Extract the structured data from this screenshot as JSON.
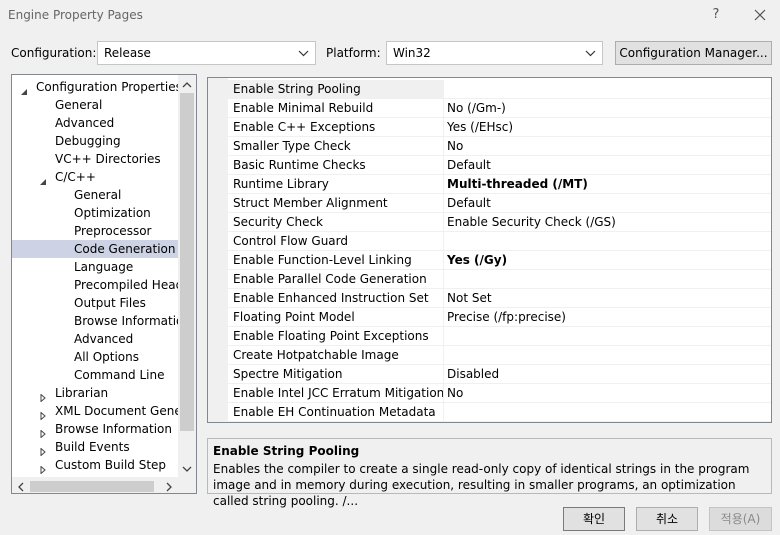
{
  "window": {
    "title": "Engine Property Pages",
    "help_glyph": "?",
    "icons": [
      "help-icon",
      "close-icon"
    ]
  },
  "toolbar": {
    "configuration_label": "Configuration:",
    "configuration_value": "Release",
    "platform_label": "Platform:",
    "platform_value": "Win32",
    "config_manager_label": "Configuration Manager..."
  },
  "tree": {
    "items": [
      {
        "label": "Configuration Properties",
        "level": 0,
        "expander": "expanded"
      },
      {
        "label": "General",
        "level": 1,
        "expander": "none"
      },
      {
        "label": "Advanced",
        "level": 1,
        "expander": "none"
      },
      {
        "label": "Debugging",
        "level": 1,
        "expander": "none"
      },
      {
        "label": "VC++ Directories",
        "level": 1,
        "expander": "none"
      },
      {
        "label": "C/C++",
        "level": 1,
        "expander": "expanded"
      },
      {
        "label": "General",
        "level": 2,
        "expander": "none"
      },
      {
        "label": "Optimization",
        "level": 2,
        "expander": "none"
      },
      {
        "label": "Preprocessor",
        "level": 2,
        "expander": "none"
      },
      {
        "label": "Code Generation",
        "level": 2,
        "expander": "none",
        "selected": true
      },
      {
        "label": "Language",
        "level": 2,
        "expander": "none"
      },
      {
        "label": "Precompiled Heade",
        "level": 2,
        "expander": "none"
      },
      {
        "label": "Output Files",
        "level": 2,
        "expander": "none"
      },
      {
        "label": "Browse Information",
        "level": 2,
        "expander": "none"
      },
      {
        "label": "Advanced",
        "level": 2,
        "expander": "none"
      },
      {
        "label": "All Options",
        "level": 2,
        "expander": "none"
      },
      {
        "label": "Command Line",
        "level": 2,
        "expander": "none"
      },
      {
        "label": "Librarian",
        "level": 1,
        "expander": "collapsed"
      },
      {
        "label": "XML Document Genera",
        "level": 1,
        "expander": "collapsed"
      },
      {
        "label": "Browse Information",
        "level": 1,
        "expander": "collapsed"
      },
      {
        "label": "Build Events",
        "level": 1,
        "expander": "collapsed"
      },
      {
        "label": "Custom Build Step",
        "level": 1,
        "expander": "collapsed"
      }
    ]
  },
  "grid": {
    "rows": [
      {
        "name": "Enable String Pooling",
        "value": "",
        "bold": false,
        "selected": true
      },
      {
        "name": "Enable Minimal Rebuild",
        "value": "No (/Gm-)",
        "bold": false
      },
      {
        "name": "Enable C++ Exceptions",
        "value": "Yes (/EHsc)",
        "bold": false
      },
      {
        "name": "Smaller Type Check",
        "value": "No",
        "bold": false
      },
      {
        "name": "Basic Runtime Checks",
        "value": "Default",
        "bold": false
      },
      {
        "name": "Runtime Library",
        "value": "Multi-threaded (/MT)",
        "bold": true
      },
      {
        "name": "Struct Member Alignment",
        "value": "Default",
        "bold": false
      },
      {
        "name": "Security Check",
        "value": "Enable Security Check (/GS)",
        "bold": false
      },
      {
        "name": "Control Flow Guard",
        "value": "",
        "bold": false
      },
      {
        "name": "Enable Function-Level Linking",
        "value": "Yes (/Gy)",
        "bold": true
      },
      {
        "name": "Enable Parallel Code Generation",
        "value": "",
        "bold": false
      },
      {
        "name": "Enable Enhanced Instruction Set",
        "value": "Not Set",
        "bold": false
      },
      {
        "name": "Floating Point Model",
        "value": "Precise (/fp:precise)",
        "bold": false
      },
      {
        "name": "Enable Floating Point Exceptions",
        "value": "",
        "bold": false
      },
      {
        "name": "Create Hotpatchable Image",
        "value": "",
        "bold": false
      },
      {
        "name": "Spectre Mitigation",
        "value": "Disabled",
        "bold": false
      },
      {
        "name": "Enable Intel JCC Erratum Mitigation",
        "value": "No",
        "bold": false
      },
      {
        "name": "Enable EH Continuation Metadata",
        "value": "",
        "bold": false
      }
    ]
  },
  "description": {
    "title": "Enable String Pooling",
    "text": "Enables the compiler to create a single read-only copy of identical strings in the program image and in memory during execution, resulting in smaller programs, an optimization called string pooling. /..."
  },
  "buttons": {
    "ok": "확인",
    "cancel": "취소",
    "apply": "적용(A)"
  },
  "colors": {
    "selection": "#cdd3e5",
    "window_bg": "#f0f0f0"
  }
}
